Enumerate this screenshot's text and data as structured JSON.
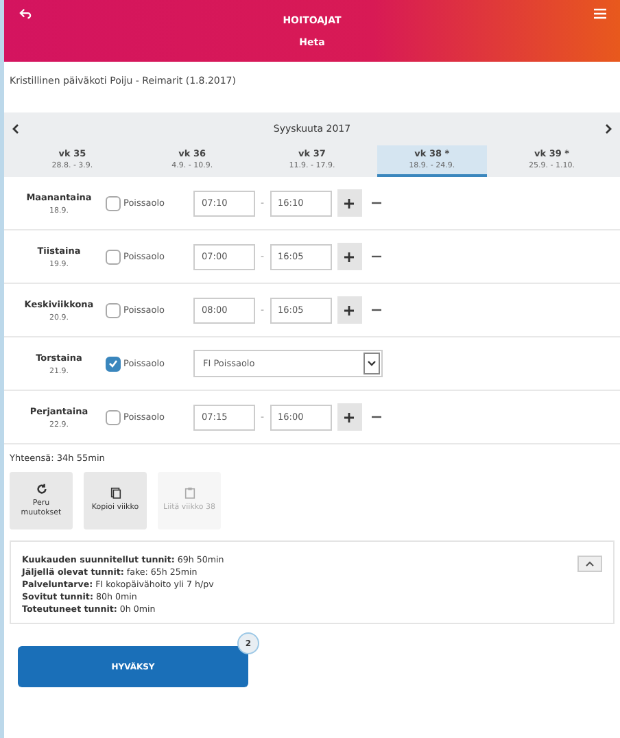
{
  "header": {
    "title": "HOITOAJAT",
    "subtitle": "Heta"
  },
  "unit": "Kristillinen päiväkoti Poiju - Reimarit  (1.8.2017)",
  "month": "Syyskuuta 2017",
  "weeks": [
    {
      "label": "vk 35",
      "dates": "28.8. - 3.9.",
      "selected": false
    },
    {
      "label": "vk 36",
      "dates": "4.9. - 10.9.",
      "selected": false
    },
    {
      "label": "vk 37",
      "dates": "11.9. - 17.9.",
      "selected": false
    },
    {
      "label": "vk 38 *",
      "dates": "18.9. - 24.9.",
      "selected": true
    },
    {
      "label": "vk 39 *",
      "dates": "25.9. - 1.10.",
      "selected": false
    }
  ],
  "days": [
    {
      "name": "Maanantaina",
      "date": "18.9.",
      "absence_label": "Poissaolo",
      "absent": false,
      "start": "07:10",
      "separator": "-",
      "end": "16:10"
    },
    {
      "name": "Tiistaina",
      "date": "19.9.",
      "absence_label": "Poissaolo",
      "absent": false,
      "start": "07:00",
      "separator": "-",
      "end": "16:05"
    },
    {
      "name": "Keskiviikkona",
      "date": "20.9.",
      "absence_label": "Poissaolo",
      "absent": false,
      "start": "08:00",
      "separator": "-",
      "end": "16:05"
    },
    {
      "name": "Torstaina",
      "date": "21.9.",
      "absence_label": "Poissaolo",
      "absent": true,
      "absence_type": "FI Poissaolo"
    },
    {
      "name": "Perjantaina",
      "date": "22.9.",
      "absence_label": "Poissaolo",
      "absent": false,
      "start": "07:15",
      "separator": "-",
      "end": "16:00"
    }
  ],
  "total": "Yhteensä: 34h 55min",
  "actions": [
    {
      "kind": "undo",
      "label": "Peru muutokset",
      "disabled": false
    },
    {
      "kind": "copy",
      "label": "Kopioi viikko",
      "disabled": false
    },
    {
      "kind": "paste",
      "label": "Liitä viikko 38",
      "disabled": true
    }
  ],
  "summary": [
    "**Kuukauden suunnitellut tunnit:** 69h 50min",
    "**Jäljellä olevat tunnit:** fake: 65h 25min",
    "**Palveluntarve:** FI kokopäivähoito yli 7 h/pv",
    "**Sovitut tunnit:** 80h 0min",
    "**Toteutuneet tunnit:** 0h 0min"
  ],
  "approve": {
    "label": "HYVÄKSY",
    "badge": "2"
  }
}
